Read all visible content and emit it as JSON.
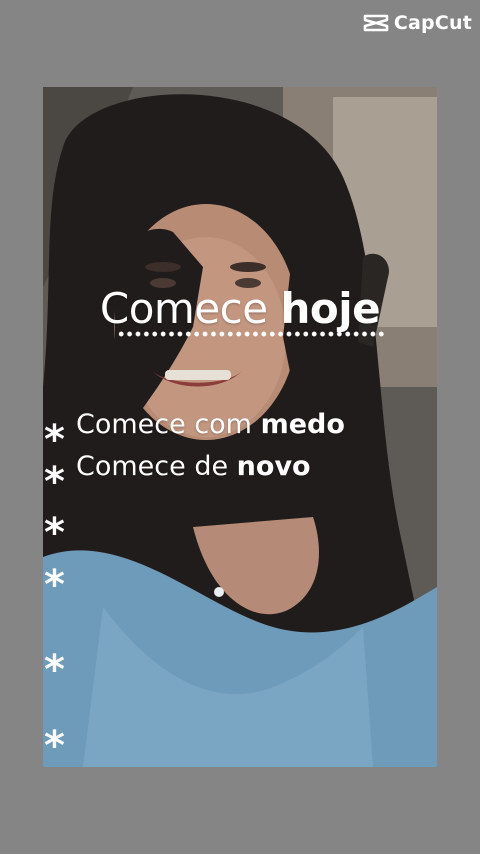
{
  "brand": {
    "logo_text": "CapCut",
    "logo_icon": "capcut-logo-icon"
  },
  "headline": {
    "regular": "Comece",
    "bold": "hoje"
  },
  "lines": [
    {
      "regular": "Comece com",
      "bold": "medo"
    },
    {
      "regular": "Comece de",
      "bold": "novo"
    }
  ],
  "stars": [
    "*",
    "*",
    "*",
    "*",
    "*",
    "*"
  ],
  "colors": {
    "background": "#858585",
    "text": "#ffffff"
  }
}
